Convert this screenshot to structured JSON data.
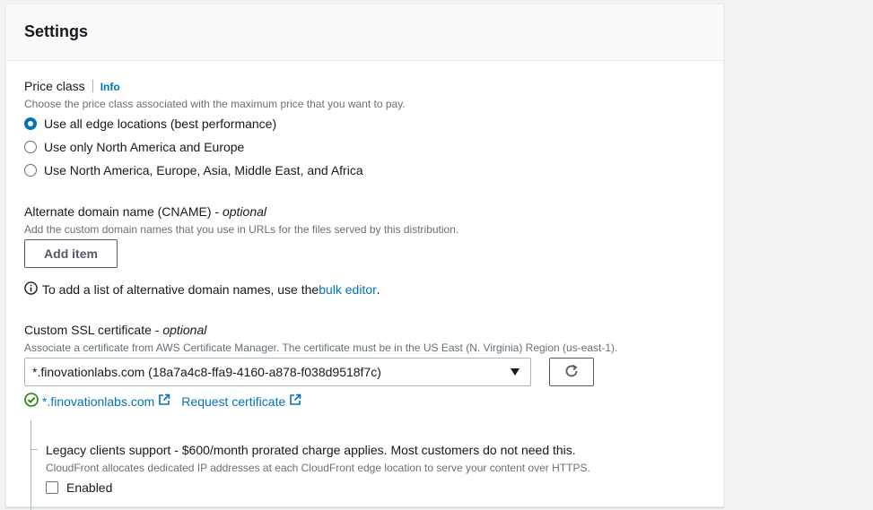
{
  "settings": {
    "title": "Settings",
    "price_class": {
      "label": "Price class",
      "info": "Info",
      "description": "Choose the price class associated with the maximum price that you want to pay.",
      "options": [
        {
          "label": "Use all edge locations (best performance)",
          "selected": true
        },
        {
          "label": "Use only North America and Europe",
          "selected": false
        },
        {
          "label": "Use North America, Europe, Asia, Middle East, and Africa",
          "selected": false
        }
      ]
    },
    "cname": {
      "label": "Alternate domain name (CNAME) - ",
      "optional": "optional",
      "description": "Add the custom domain names that you use in URLs for the files served by this distribution.",
      "add_button": "Add item",
      "hint_prefix": "To add a list of alternative domain names, use the ",
      "hint_link": "bulk editor",
      "hint_suffix": "."
    },
    "ssl": {
      "label": "Custom SSL certificate - ",
      "optional": "optional",
      "description": "Associate a certificate from AWS Certificate Manager. The certificate must be in the US East (N. Virginia) Region (us-east-1).",
      "selected_value": "*.finovationlabs.com (18a7a4c8-ffa9-4160-a878-f038d9518f7c)",
      "cert_link": "*.finovationlabs.com",
      "request_link": "Request certificate"
    },
    "legacy": {
      "label": "Legacy clients support - $600/month prorated charge applies. Most customers do not need this.",
      "description": "CloudFront allocates dedicated IP addresses at each CloudFront edge location to serve your content over HTTPS.",
      "checkbox_label": "Enabled",
      "checked": false
    }
  },
  "colors": {
    "accent": "#0073bb",
    "success": "#1d8102",
    "text": "#16191f",
    "muted": "#687078"
  }
}
